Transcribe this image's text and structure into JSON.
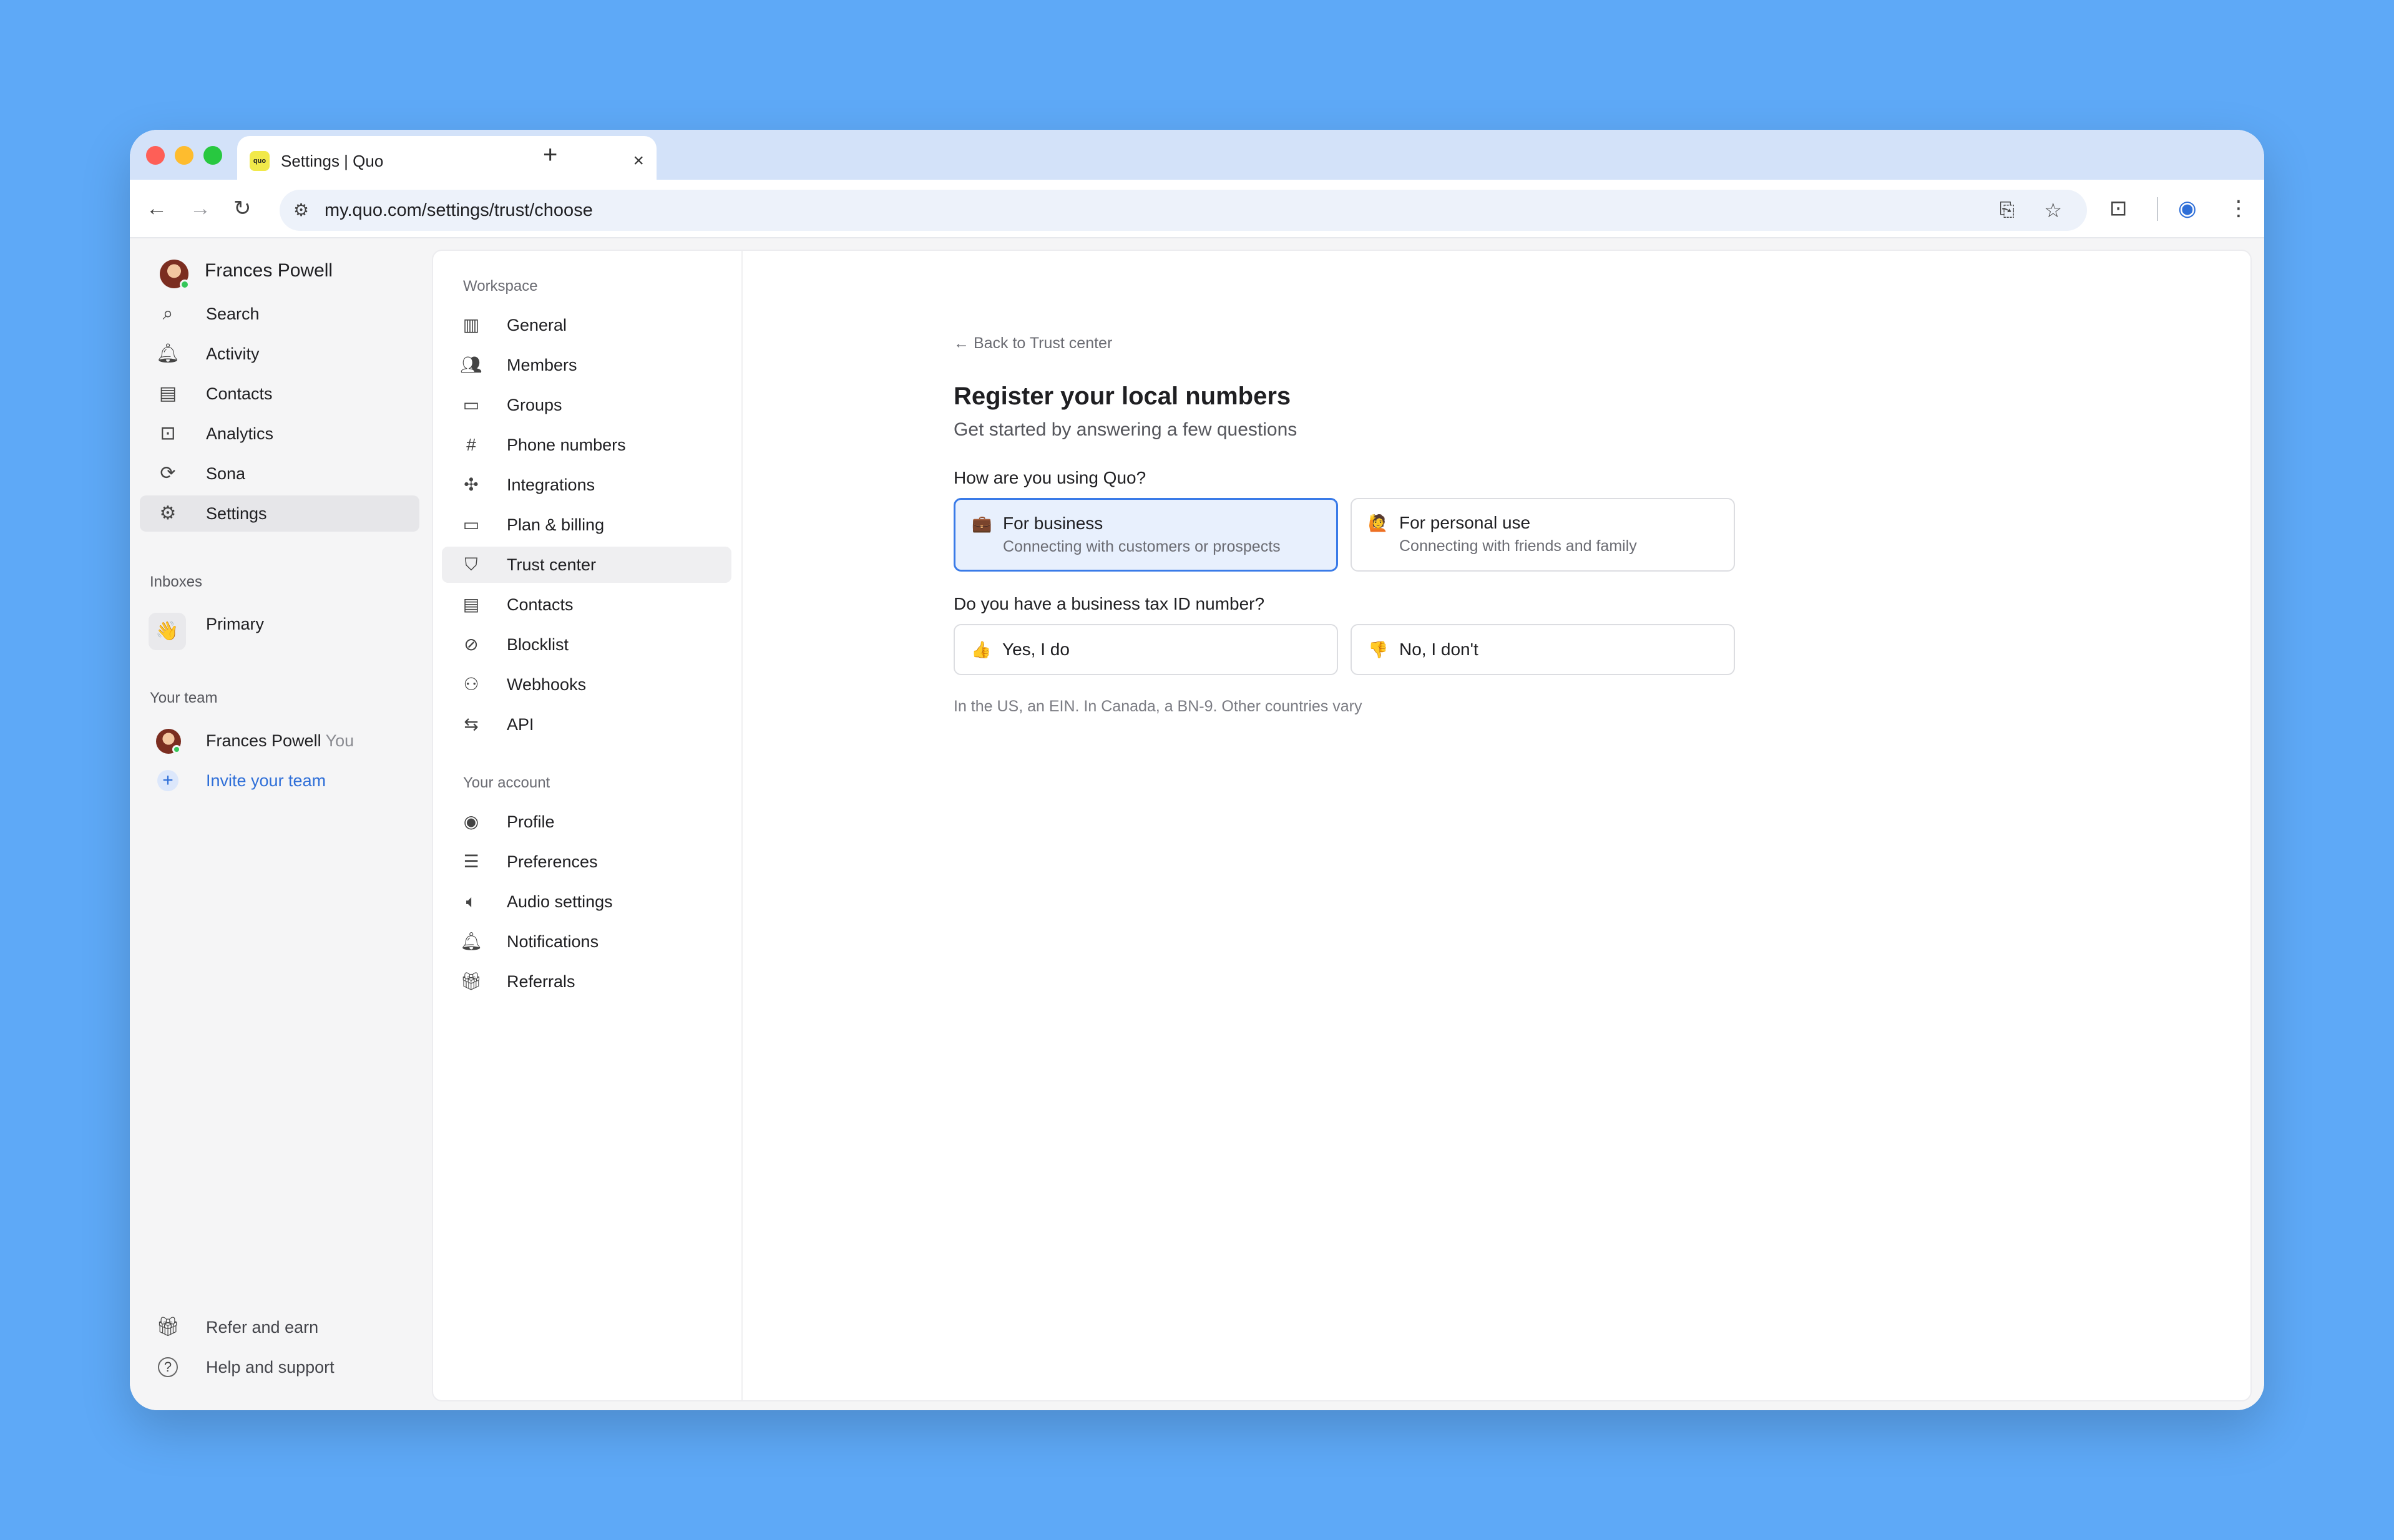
{
  "browser": {
    "tab_title": "Settings | Quo",
    "tab_logo_text": "quo",
    "tab_close": "×",
    "new_tab": "+",
    "url": "my.quo.com/settings/trust/choose",
    "traffic_colors": [
      "#fe5f57",
      "#febc2e",
      "#28c840"
    ]
  },
  "sidebar": {
    "user_name": "Frances Powell",
    "items": [
      {
        "label": "Search",
        "icon": "search-icon",
        "glyph": "⌕"
      },
      {
        "label": "Activity",
        "icon": "bell-icon",
        "glyph": "🔔︎"
      },
      {
        "label": "Contacts",
        "icon": "contacts-icon",
        "glyph": "▤"
      },
      {
        "label": "Analytics",
        "icon": "analytics-icon",
        "glyph": "⊡"
      },
      {
        "label": "Sona",
        "icon": "sona-icon",
        "glyph": "⟳"
      },
      {
        "label": "Settings",
        "icon": "gear-icon",
        "glyph": "⚙"
      }
    ],
    "inboxes_heading": "Inboxes",
    "inbox": {
      "emoji": "👋",
      "label": "Primary"
    },
    "team_heading": "Your team",
    "team_member": {
      "name": "Frances Powell",
      "tag": "You"
    },
    "invite_label": "Invite your team",
    "invite_glyph": "+",
    "footer": [
      {
        "label": "Refer and earn",
        "icon": "gift-icon",
        "glyph": "🎁︎"
      },
      {
        "label": "Help and support",
        "icon": "help-icon",
        "glyph": "?"
      }
    ]
  },
  "settings_nav": {
    "workspace_heading": "Workspace",
    "workspace_items": [
      {
        "label": "General",
        "icon": "building-icon",
        "glyph": "▥"
      },
      {
        "label": "Members",
        "icon": "members-icon",
        "glyph": "👥︎"
      },
      {
        "label": "Groups",
        "icon": "folder-icon",
        "glyph": "▭"
      },
      {
        "label": "Phone numbers",
        "icon": "hash-icon",
        "glyph": "#"
      },
      {
        "label": "Integrations",
        "icon": "integrations-icon",
        "glyph": "✣"
      },
      {
        "label": "Plan & billing",
        "icon": "card-icon",
        "glyph": "▭"
      },
      {
        "label": "Trust center",
        "icon": "shield-icon",
        "glyph": "⛉"
      },
      {
        "label": "Contacts",
        "icon": "contacts-icon",
        "glyph": "▤"
      },
      {
        "label": "Blocklist",
        "icon": "block-icon",
        "glyph": "⊘"
      },
      {
        "label": "Webhooks",
        "icon": "webhook-icon",
        "glyph": "⚇"
      },
      {
        "label": "API",
        "icon": "api-icon",
        "glyph": "⇆"
      }
    ],
    "account_heading": "Your account",
    "account_items": [
      {
        "label": "Profile",
        "icon": "profile-icon",
        "glyph": "◉"
      },
      {
        "label": "Preferences",
        "icon": "sliders-icon",
        "glyph": "☰"
      },
      {
        "label": "Audio settings",
        "icon": "speaker-icon",
        "glyph": "🔈︎"
      },
      {
        "label": "Notifications",
        "icon": "bell-icon",
        "glyph": "🔔︎"
      },
      {
        "label": "Referrals",
        "icon": "gift-icon",
        "glyph": "🎁︎"
      }
    ]
  },
  "main": {
    "back_link": "Back to Trust center",
    "back_arrow": "←",
    "title": "Register your local numbers",
    "subtitle": "Get started by answering a few questions",
    "q1": "How are you using Quo?",
    "q1_options": [
      {
        "emoji": "💼",
        "title": "For business",
        "desc": "Connecting with customers or prospects",
        "selected": true
      },
      {
        "emoji": "🙋",
        "title": "For personal use",
        "desc": "Connecting with friends and family",
        "selected": false
      }
    ],
    "q2": "Do you have a business tax ID number?",
    "q2_options": [
      {
        "emoji": "👍",
        "title": "Yes, I do"
      },
      {
        "emoji": "👎",
        "title": "No, I don't"
      }
    ],
    "hint": "In the US, an EIN. In Canada, a BN-9. Other countries vary"
  },
  "colors": {
    "accent": "#3a7be8",
    "selected_bg": "#e8f0fd",
    "invite_text": "#2f6fd8",
    "page_bg": "#5ea9f7"
  }
}
